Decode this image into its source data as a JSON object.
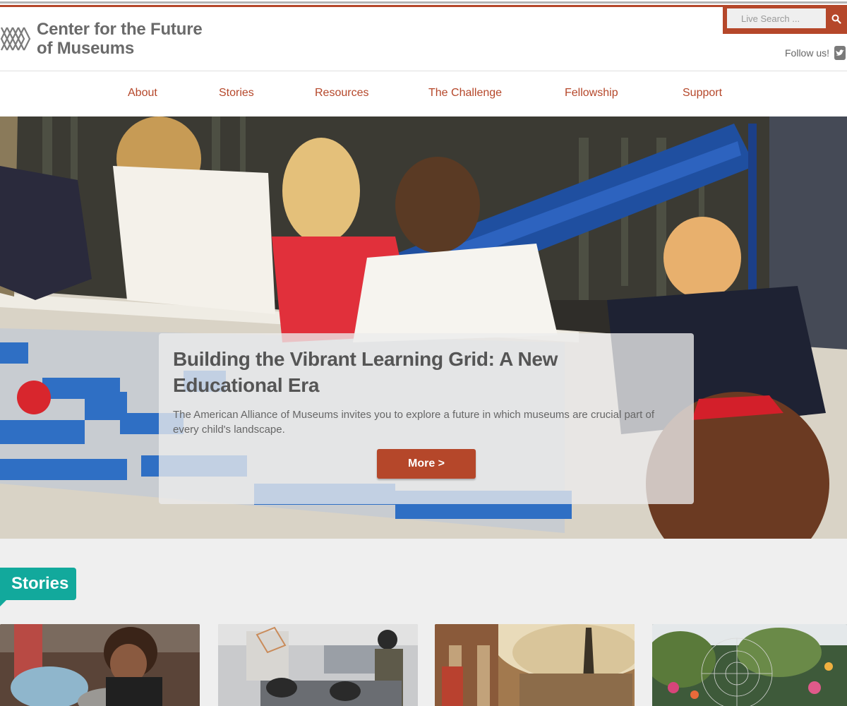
{
  "logo": {
    "line1": "Center for the Future",
    "line2": "of Museums"
  },
  "search": {
    "placeholder": "Live Search ..."
  },
  "follow": {
    "label": "Follow us!"
  },
  "nav": {
    "items": [
      "About",
      "Stories",
      "Resources",
      "The Challenge",
      "Fellowship",
      "Support"
    ]
  },
  "hero": {
    "title": "Building the Vibrant Learning Grid: A New Educational Era",
    "description": "The American Alliance of Museums invites you to explore a future in which museums are crucial part of every child's landscape.",
    "button_label": "More >"
  },
  "stories": {
    "label": "Stories"
  },
  "colors": {
    "accent": "#b5472a",
    "teal": "#12a99c",
    "text_gray": "#6a6a6a"
  },
  "icons": {
    "logo": "lattice-logo-icon",
    "search": "search-icon",
    "twitter": "twitter-icon"
  }
}
